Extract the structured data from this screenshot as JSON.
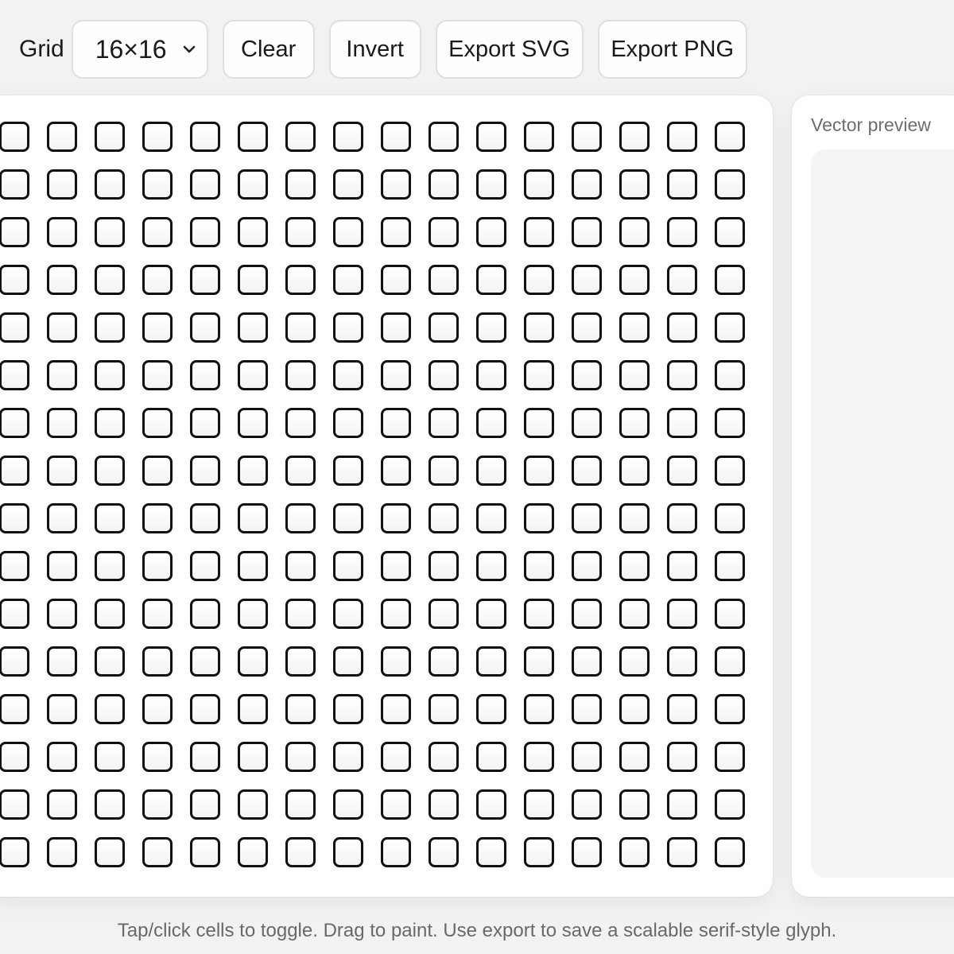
{
  "toolbar": {
    "grid_label": "Grid",
    "grid_size_value": "16×16",
    "clear_label": "Clear",
    "invert_label": "Invert",
    "export_svg_label": "Export SVG",
    "export_png_label": "Export PNG"
  },
  "preview": {
    "title": "Vector preview"
  },
  "footer": {
    "text": "Tap/click cells to toggle. Drag to paint. Use export to save a scalable serif-style glyph."
  },
  "grid": {
    "rows": 16,
    "cols": 16
  }
}
